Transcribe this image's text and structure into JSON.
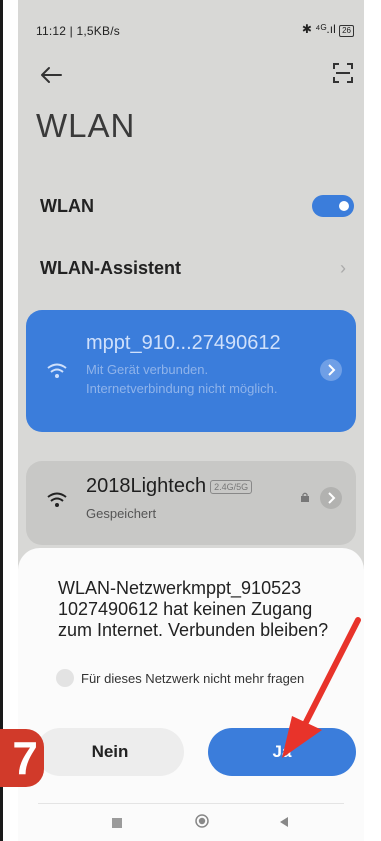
{
  "status_bar": {
    "left_text": "11:12 | 1,5KB/s",
    "right_text": "✱ ⁴ᴳ.ıl",
    "battery": "26"
  },
  "header": {
    "title": "WLAN"
  },
  "settings": {
    "wlan_label": "WLAN",
    "wlan_enabled": true,
    "assistant_label": "WLAN-Assistent"
  },
  "networks": [
    {
      "name": "mppt_910...27490612",
      "status": "Mit Gerät verbunden. Internetverbindung nicht möglich."
    },
    {
      "name": "2018Lightech",
      "band": "2.4G/5G",
      "status": "Gespeichert"
    }
  ],
  "dialog": {
    "message": "WLAN-Netzwerkmppt_910523 1027490612 hat keinen Zugang zum Internet. Verbunden bleiben?",
    "checkbox_label": "Für dieses Netzwerk nicht mehr fragen",
    "no_button": "Nein",
    "yes_button": "Ja"
  },
  "annotation": {
    "step_number": "7"
  },
  "colors": {
    "accent": "#3b7ddb",
    "annotation_red": "#d13a2a"
  }
}
